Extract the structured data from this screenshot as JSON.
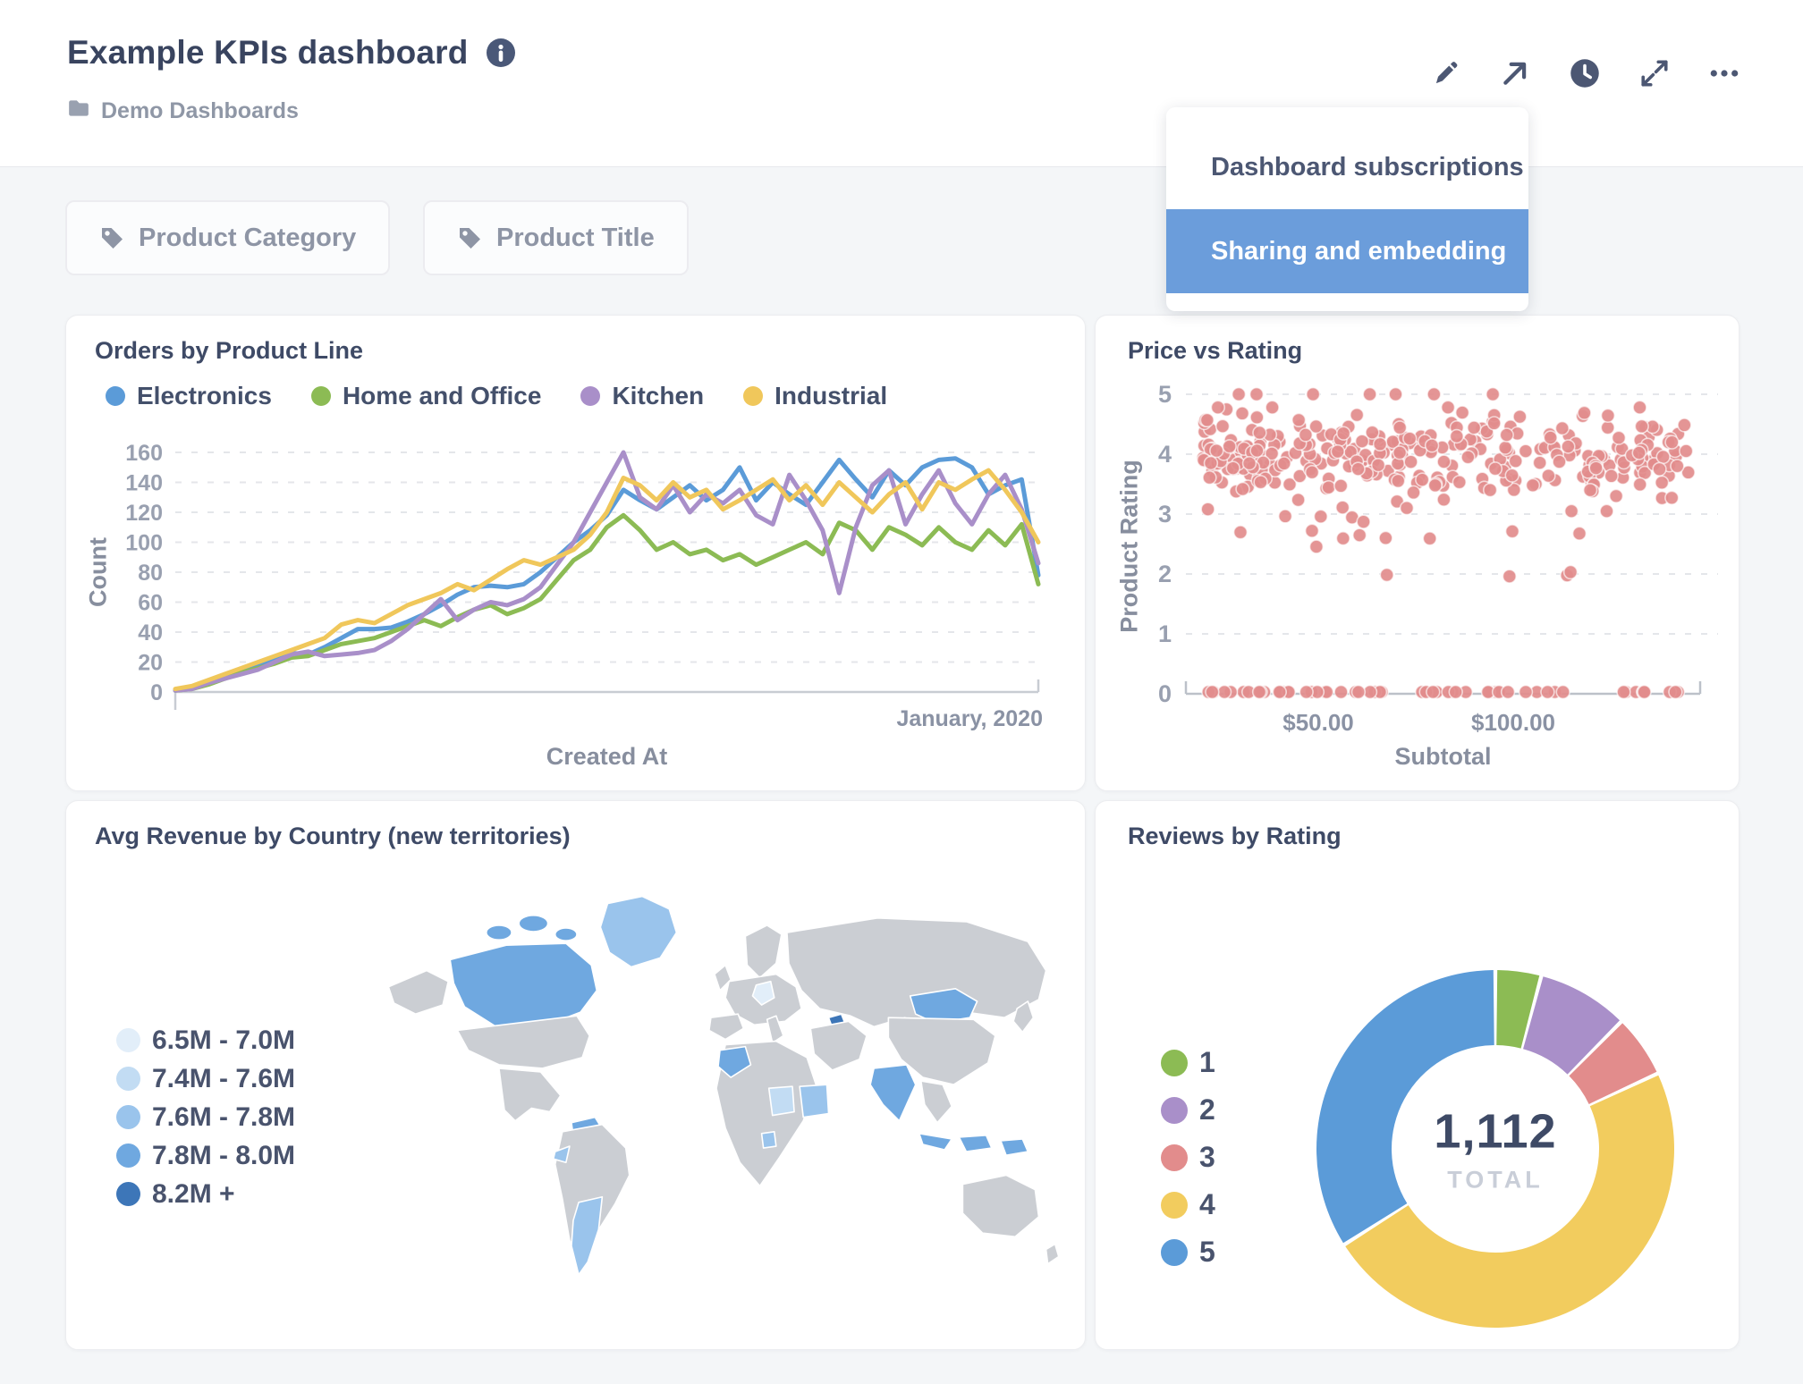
{
  "header": {
    "title": "Example KPIs dashboard",
    "collection": "Demo Dashboards",
    "actions": [
      {
        "name": "edit-dashboard",
        "icon": "pencil-icon"
      },
      {
        "name": "share",
        "icon": "share-arrow-icon"
      },
      {
        "name": "history",
        "icon": "clock-icon"
      },
      {
        "name": "fullscreen",
        "icon": "expand-icon"
      },
      {
        "name": "more-options",
        "icon": "ellipsis-icon"
      }
    ]
  },
  "share_menu": {
    "items": [
      {
        "label": "Dashboard subscriptions",
        "active": false
      },
      {
        "label": "Sharing and embedding",
        "active": true
      }
    ],
    "highlight_color": "#6b9ddb"
  },
  "filters": [
    {
      "label": "Product Category",
      "icon": "tag-icon"
    },
    {
      "label": "Product Title",
      "icon": "tag-icon"
    }
  ],
  "palette": {
    "blue": "#5b9bd8",
    "green": "#8cbb54",
    "purple": "#a98fc9",
    "yellow": "#f0c75b",
    "salmon": "#e28c8c",
    "map_grey": "#cbced3",
    "menu_highlight": "#6b9ddb"
  },
  "chart_data": [
    {
      "id": "orders_by_product_line",
      "type": "line",
      "title": "Orders by Product Line",
      "xlabel": "Created At",
      "ylabel": "Count",
      "x_axis_end_label": "January, 2020",
      "ylim": [
        0,
        160
      ],
      "y_ticks": [
        0,
        20,
        40,
        60,
        80,
        100,
        120,
        140,
        160
      ],
      "grid": "dashed-horizontal",
      "legend_position": "top",
      "series": [
        {
          "name": "Electronics",
          "color": "#5b9bd8",
          "values": [
            1,
            3,
            6,
            10,
            14,
            18,
            22,
            26,
            25,
            30,
            36,
            42,
            42,
            43,
            47,
            52,
            58,
            65,
            70,
            71,
            70,
            72,
            80,
            90,
            100,
            108,
            118,
            135,
            128,
            122,
            130,
            138,
            128,
            135,
            150,
            128,
            140,
            132,
            125,
            140,
            155,
            142,
            130,
            148,
            138,
            150,
            155,
            156,
            150,
            132,
            138,
            142,
            78
          ]
        },
        {
          "name": "Home and Office",
          "color": "#8cbb54",
          "values": [
            1,
            2,
            5,
            9,
            13,
            16,
            19,
            23,
            24,
            28,
            32,
            34,
            36,
            40,
            44,
            48,
            44,
            50,
            55,
            58,
            52,
            56,
            62,
            75,
            88,
            95,
            110,
            118,
            108,
            95,
            100,
            92,
            95,
            88,
            92,
            85,
            90,
            95,
            100,
            92,
            113,
            108,
            95,
            110,
            105,
            98,
            110,
            100,
            95,
            108,
            98,
            112,
            72
          ]
        },
        {
          "name": "Kitchen",
          "color": "#a98fc9",
          "values": [
            1,
            2,
            6,
            9,
            12,
            15,
            20,
            25,
            27,
            24,
            25,
            26,
            28,
            34,
            42,
            52,
            62,
            48,
            55,
            60,
            58,
            62,
            70,
            85,
            100,
            120,
            140,
            160,
            130,
            122,
            138,
            120,
            132,
            126,
            135,
            118,
            112,
            145,
            128,
            108,
            66,
            110,
            138,
            148,
            112,
            132,
            148,
            126,
            112,
            132,
            145,
            122,
            86
          ]
        },
        {
          "name": "Industrial",
          "color": "#f0c75b",
          "values": [
            2,
            4,
            8,
            12,
            16,
            20,
            24,
            28,
            32,
            36,
            45,
            48,
            46,
            52,
            58,
            62,
            66,
            72,
            68,
            75,
            82,
            88,
            85,
            90,
            95,
            105,
            120,
            143,
            138,
            128,
            140,
            130,
            135,
            122,
            128,
            135,
            142,
            128,
            138,
            125,
            140,
            130,
            120,
            132,
            140,
            122,
            140,
            135,
            142,
            148,
            135,
            120,
            100
          ]
        }
      ]
    },
    {
      "id": "price_vs_rating",
      "type": "scatter",
      "title": "Price vs Rating",
      "xlabel": "Subtotal",
      "ylabel": "Product Rating",
      "x_ticks": [
        "$50.00",
        "$100.00"
      ],
      "x_tick_values": [
        50,
        100
      ],
      "xlim": [
        16,
        148
      ],
      "ylim": [
        0,
        5
      ],
      "y_ticks": [
        0,
        1,
        2,
        3,
        4,
        5
      ],
      "grid": "dashed-horizontal",
      "point_color": "#e28c8c",
      "distribution": {
        "seed": 1337,
        "bands": [
          {
            "n": 330,
            "x": [
              20,
              145
            ],
            "x_exp": 1.25,
            "y": "gauss",
            "y_mean": 3.95,
            "y_sd": 0.38,
            "y_clip": [
              3.05,
              4.78
            ]
          },
          {
            "n": 7,
            "x": [
              22,
              112
            ],
            "y": "const",
            "y_const": 5
          },
          {
            "n": 13,
            "x": [
              24,
              118
            ],
            "y": "uniform",
            "y_range": [
              2.42,
              3.02
            ]
          },
          {
            "n": 4,
            "x": [
              62,
              116
            ],
            "y": "uniform",
            "y_range": [
              1.96,
              2.04
            ]
          },
          {
            "n": 58,
            "x": [
              21,
              143
            ],
            "x_exp": 1.1,
            "y": "const",
            "y_const": 0.03
          }
        ]
      }
    },
    {
      "id": "avg_revenue_by_country",
      "type": "map",
      "title": "Avg Revenue by Country (new territories)",
      "legend": [
        {
          "label": "6.5M - 7.0M",
          "color": "#e2eef9"
        },
        {
          "label": "7.4M - 7.6M",
          "color": "#c2dcf3"
        },
        {
          "label": "7.6M - 7.8M",
          "color": "#9ac4ec"
        },
        {
          "label": "7.8M - 8.0M",
          "color": "#6fa8e0"
        },
        {
          "label": "8.2M +",
          "color": "#3d76b8"
        }
      ],
      "highlighted_countries": [
        "Canada",
        "Greenland",
        "Venezuela",
        "Ecuador",
        "Argentina",
        "Germany",
        "Morocco",
        "Chad",
        "Sudan",
        "Gabon",
        "Azerbaijan",
        "Mongolia",
        "India",
        "Indonesia",
        "Papua New Guinea"
      ]
    },
    {
      "id": "reviews_by_rating",
      "type": "donut",
      "title": "Reviews by Rating",
      "total": "1,112",
      "total_label": "TOTAL",
      "slices": [
        {
          "label": "1",
          "value": 46,
          "color": "#8cbb54"
        },
        {
          "label": "2",
          "value": 92,
          "color": "#a98fc9"
        },
        {
          "label": "3",
          "value": 63,
          "color": "#e28c8c"
        },
        {
          "label": "4",
          "value": 533,
          "color": "#f2cc5e"
        },
        {
          "label": "5",
          "value": 378,
          "color": "#5b9bd8"
        }
      ]
    }
  ]
}
